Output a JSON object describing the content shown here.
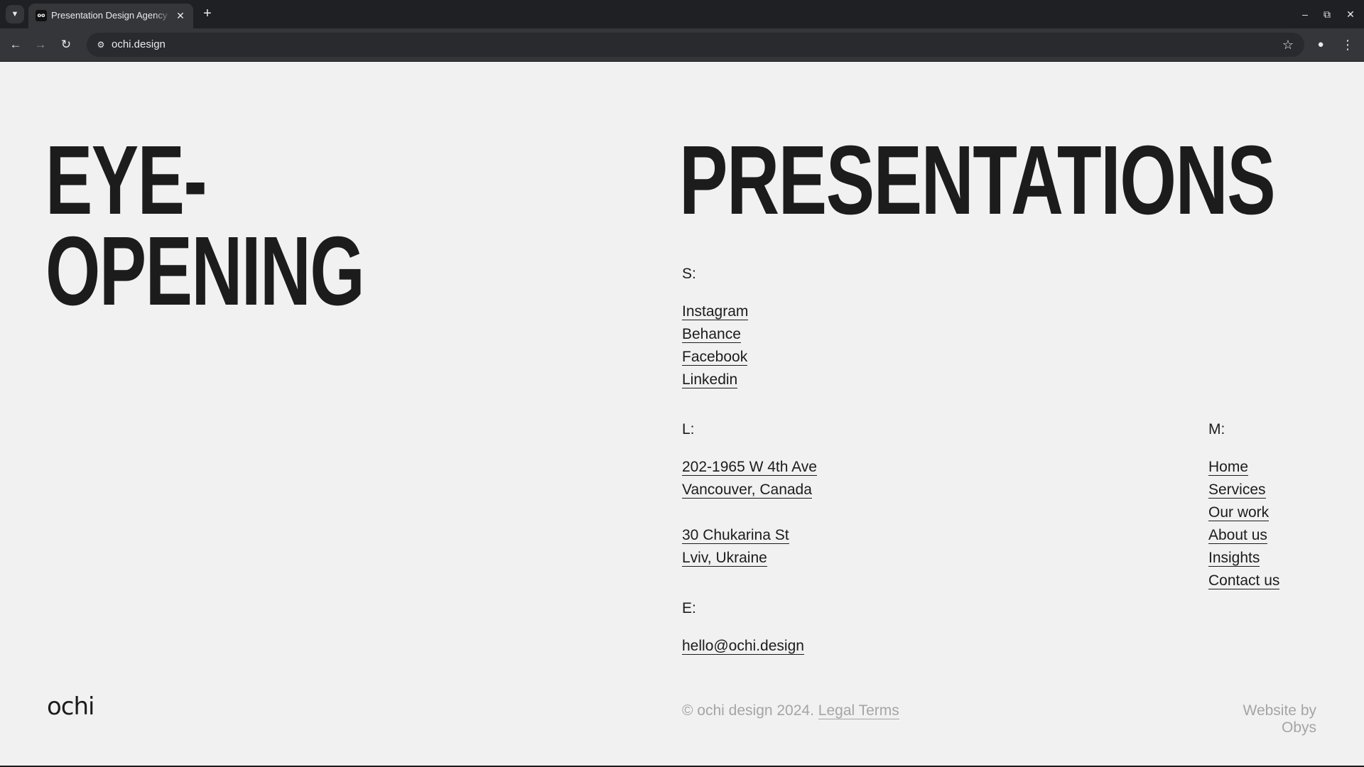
{
  "browser": {
    "tab_title": "Presentation Design Agency",
    "favicon_text": "oo",
    "url": "ochi.design",
    "icons": [
      "tab-search-icon",
      "close-icon",
      "plus-icon",
      "minimize-icon",
      "restore-icon",
      "close-window-icon",
      "back-icon",
      "forward-icon",
      "reload-icon",
      "site-info-icon",
      "star-icon",
      "profile-icon",
      "kebab-icon"
    ]
  },
  "page": {
    "headline_left": [
      "EYE-",
      "OPENING"
    ],
    "headline_right": "PRESENTATIONS",
    "socials": {
      "label": "S:",
      "links": [
        "Instagram",
        "Behance",
        "Facebook",
        "Linkedin"
      ]
    },
    "locations": {
      "label": "L:",
      "addresses": [
        [
          "202-1965 W 4th Ave",
          "Vancouver, Canada"
        ],
        [
          "30 Chukarina St",
          "Lviv, Ukraine"
        ]
      ]
    },
    "menu": {
      "label": "M:",
      "links": [
        "Home",
        "Services",
        "Our work",
        "About us",
        "Insights",
        "Contact us"
      ]
    },
    "email": {
      "label": "E:",
      "address": "hello@ochi.design"
    },
    "logo": "ochi",
    "footer": {
      "copyright": "© ochi design 2024.",
      "legal": "Legal Terms",
      "credit": "Website by Obys"
    }
  }
}
